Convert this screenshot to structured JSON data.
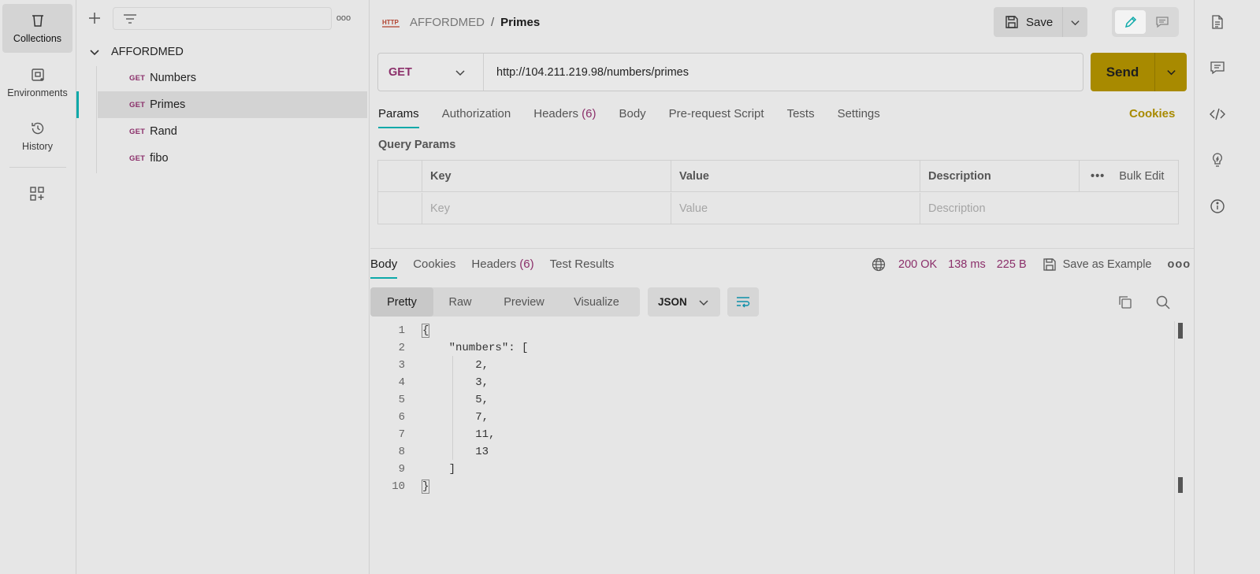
{
  "rail": {
    "items": [
      {
        "label": "Collections"
      },
      {
        "label": "Environments"
      },
      {
        "label": "History"
      }
    ]
  },
  "sidebar": {
    "filter_placeholder": "",
    "more_label": "ooo",
    "collection": {
      "name": "AFFORDMED",
      "requests": [
        {
          "method": "GET",
          "name": "Numbers"
        },
        {
          "method": "GET",
          "name": "Primes"
        },
        {
          "method": "GET",
          "name": "Rand"
        },
        {
          "method": "GET",
          "name": "fibo"
        }
      ]
    }
  },
  "header": {
    "breadcrumb_parent": "AFFORDMED",
    "breadcrumb_sep": "/",
    "breadcrumb_current": "Primes",
    "save_label": "Save"
  },
  "request": {
    "method": "GET",
    "url": "http://104.211.219.98/numbers/primes",
    "send_label": "Send",
    "tabs": [
      {
        "label": "Params"
      },
      {
        "label": "Authorization"
      },
      {
        "label": "Headers",
        "count": "(6)"
      },
      {
        "label": "Body"
      },
      {
        "label": "Pre-request Script"
      },
      {
        "label": "Tests"
      },
      {
        "label": "Settings"
      }
    ],
    "cookies_label": "Cookies",
    "query_params_title": "Query Params",
    "table": {
      "headers": [
        "Key",
        "Value",
        "Description"
      ],
      "placeholders": [
        "Key",
        "Value",
        "Description"
      ],
      "bulk_dots": "•••",
      "bulk_edit_label": "Bulk Edit"
    }
  },
  "response": {
    "tabs": [
      {
        "label": "Body"
      },
      {
        "label": "Cookies"
      },
      {
        "label": "Headers",
        "count": "(6)"
      },
      {
        "label": "Test Results"
      }
    ],
    "status": "200 OK",
    "time": "138 ms",
    "size": "225 B",
    "save_example_label": "Save as Example",
    "more_label": "ooo",
    "formats": [
      "Pretty",
      "Raw",
      "Preview",
      "Visualize"
    ],
    "language": "JSON",
    "lines": [
      {
        "n": "1",
        "text": "{"
      },
      {
        "n": "2",
        "text": "    \"numbers\": ["
      },
      {
        "n": "3",
        "text": "        2,"
      },
      {
        "n": "4",
        "text": "        3,"
      },
      {
        "n": "5",
        "text": "        5,"
      },
      {
        "n": "6",
        "text": "        7,"
      },
      {
        "n": "7",
        "text": "        11,"
      },
      {
        "n": "8",
        "text": "        13"
      },
      {
        "n": "9",
        "text": "    ]"
      },
      {
        "n": "10",
        "text": "}"
      }
    ]
  },
  "colors": {
    "accent_teal": "#0da9a9",
    "method_purple": "#8b2f6a",
    "send_gold": "#a88a00"
  }
}
